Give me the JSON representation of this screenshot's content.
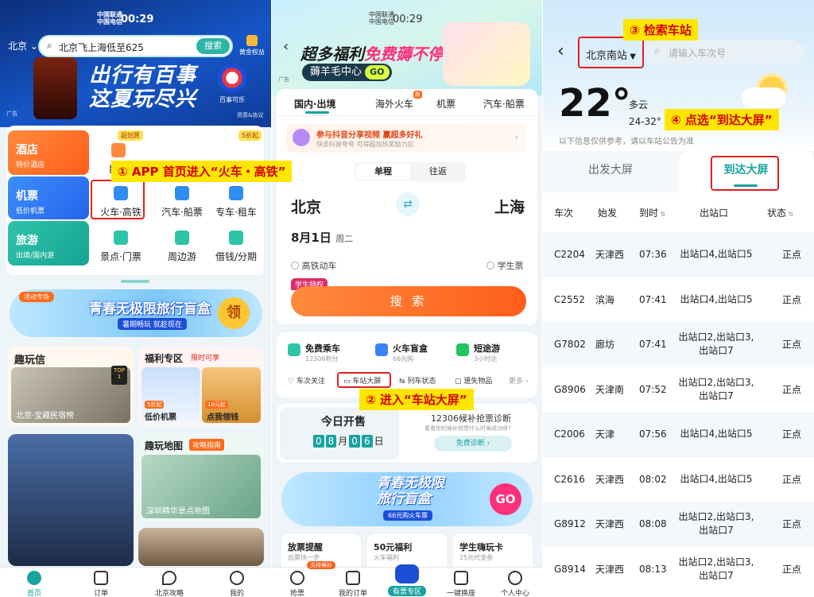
{
  "panel1": {
    "status_carrier1": "中国联通",
    "status_carrier2": "中国电信",
    "status_time": "00:29",
    "city": "北京",
    "search_placeholder": "北京飞上海低至625",
    "search_button": "搜索",
    "gold_label": "黄金权益",
    "banner_title1": "出行有百事",
    "banner_title2": "这夏玩尽兴",
    "banner_brand": "百事可乐",
    "ad_label": "广告",
    "ad_info": "资质&协议",
    "grid": {
      "hotel": {
        "title": "酒店",
        "sub": "特价酒店"
      },
      "flight": {
        "title": "机票",
        "sub": "低价机票"
      },
      "travel": {
        "title": "旅游",
        "sub": "出境/国内游"
      },
      "minsu": "民宿",
      "badge_super": "超划算",
      "badge_discount": "5折起",
      "train": "火车·高铁",
      "bus": "汽车·船票",
      "taxi": "专车·租车",
      "scenic": "景点·门票",
      "nearby": "周边游",
      "loan": "借钱/分期"
    },
    "promo_title": "青春无极限旅行盲盒",
    "promo_sub": "暑期畅玩 就趁现在",
    "promo_tag": "活动专场",
    "promo_btn": "领",
    "fun_title": "趣玩信",
    "fun_caption": "北京·宝藏民宿榜",
    "top_badge": "TOP 1",
    "welfare_title": "福利专区",
    "welfare_limited": "限时可享",
    "welfare_item1": "低价机票",
    "welfare_item2": "点我领钱",
    "welfare_badge1": "5折起",
    "welfare_badge2": "10元起",
    "map_title": "趣玩地图",
    "map_tag": "攻略指南",
    "map_caption": "深圳精华景点地图",
    "tabs": [
      "首页",
      "订单",
      "北京攻略",
      "我的"
    ]
  },
  "panel2": {
    "status_carrier1": "中国联通",
    "status_carrier2": "中国电信",
    "status_time": "00:29",
    "banner_title_a": "超多福利",
    "banner_title_b": "免费薅不停",
    "banner_sub": "薅羊毛中心",
    "banner_go": "GO",
    "ad_label": "广告",
    "tabs": [
      "国内·出境",
      "海外火车",
      "机票",
      "汽车·船票"
    ],
    "tab_new": "新",
    "share_title": "参与抖音分享视频 赢超多好礼",
    "share_sub": "快去抖音夸夸 可得超加热奖励力后",
    "trip_single": "单程",
    "trip_round": "往返",
    "from_city": "北京",
    "to_city": "上海",
    "date": "8月1日",
    "weekday": "周二",
    "opt_highspeed": "高铁动车",
    "opt_student": "学生票",
    "student_badge": "学生特权",
    "search_btn": "搜 索",
    "svc1_title": "免费乘车",
    "svc1_sub": "12306积分",
    "svc2_title": "火车盲盒",
    "svc2_sub": "66元购",
    "svc3_title": "短途游",
    "svc3_sub": "3小时达",
    "links": [
      "车次关注",
      "车站大屏",
      "列车状态",
      "遗失物品",
      "更多"
    ],
    "presale_title": "今日开售",
    "presale_digits": [
      "0",
      "8",
      "0",
      "6"
    ],
    "presale_month": "月",
    "presale_day": "日",
    "diag_title": "12306候补抢票诊断",
    "diag_sub": "看看你的候补抢票什么时候成功呀?",
    "diag_btn": "免费诊断",
    "banner2_title1": "青春无极限",
    "banner2_title2": "旅行盲盒",
    "banner2_sub": "66元购火车票",
    "banner2_go": "GO",
    "bottom_cards": [
      {
        "title": "放票提醒",
        "sub": "出票快一步"
      },
      {
        "title": "50元福利",
        "sub": "火车福利"
      },
      {
        "title": "学生嗨玩卡",
        "sub": "25元代金券"
      }
    ],
    "tabs_bottom": [
      "抢票",
      "我的订单",
      "有票专区",
      "一键换座",
      "个人中心"
    ],
    "grab_badge": "支持候补"
  },
  "panel3": {
    "station": "北京南站",
    "search_placeholder": "请输入车次号",
    "temperature": "22°",
    "weather": "多云",
    "temp_range": "24-32°",
    "notice": "以下信息仅供参考，请以车站公告为准",
    "tab_depart": "出发大屏",
    "tab_arrive": "到达大屏",
    "columns": [
      "车次",
      "始发",
      "到时",
      "出站口",
      "状态"
    ],
    "rows": [
      {
        "train": "C2204",
        "origin": "天津西",
        "time": "07:36",
        "exit": "出站口4,出站口5",
        "status": "正点"
      },
      {
        "train": "C2552",
        "origin": "滨海",
        "time": "07:41",
        "exit": "出站口4,出站口5",
        "status": "正点"
      },
      {
        "train": "G7802",
        "origin": "廊坊",
        "time": "07:41",
        "exit": "出站口2,出站口3,出站口7",
        "status": "正点"
      },
      {
        "train": "G8906",
        "origin": "天津南",
        "time": "07:52",
        "exit": "出站口2,出站口3,出站口7",
        "status": "正点"
      },
      {
        "train": "C2006",
        "origin": "天津",
        "time": "07:56",
        "exit": "出站口4,出站口5",
        "status": "正点"
      },
      {
        "train": "C2616",
        "origin": "天津西",
        "time": "08:02",
        "exit": "出站口4,出站口5",
        "status": "正点"
      },
      {
        "train": "G8912",
        "origin": "天津西",
        "time": "08:08",
        "exit": "出站口2,出站口3,出站口7",
        "status": "正点"
      },
      {
        "train": "G8914",
        "origin": "天津西",
        "time": "08:13",
        "exit": "出站口2,出站口3,出站口7",
        "status": "正点"
      }
    ]
  },
  "callouts": {
    "step1": "① APP 首页进入“火车・高铁”",
    "step2": "② 进入“车站大屏”",
    "step3": "③ 检索车站",
    "step4": "④ 点选“到达大屏”"
  },
  "colors": {
    "accent_orange": "#ff6a1a",
    "callout_yellow": "#ffe600",
    "callout_red": "#d40000",
    "teal": "#17a2a8"
  }
}
